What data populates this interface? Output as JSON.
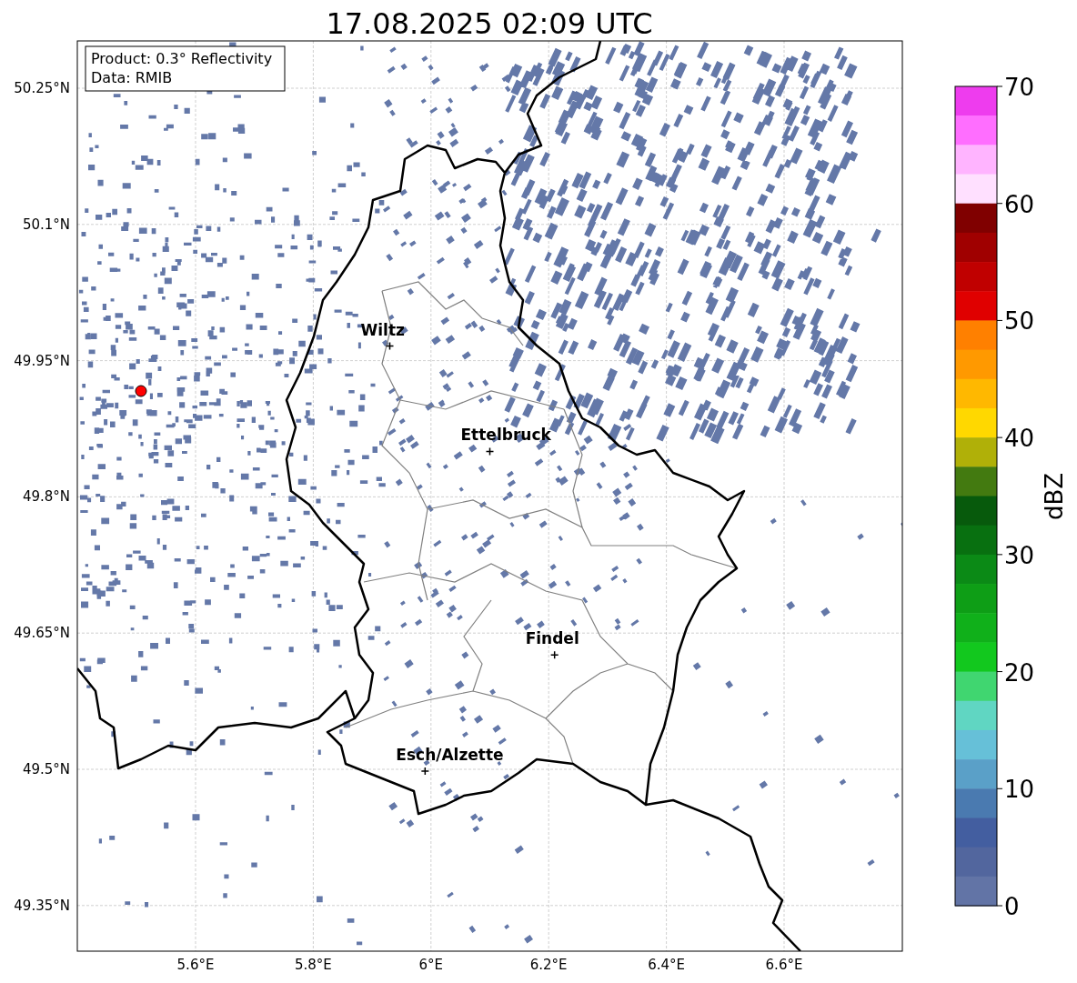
{
  "title": "17.08.2025 02:09 UTC",
  "info_box": [
    "Product: 0.3° Reflectivity",
    "Data: RMIB"
  ],
  "map": {
    "latitude_labels": [
      "50.25°N",
      "50.1°N",
      "49.95°N",
      "49.8°N",
      "49.65°N",
      "49.5°N",
      "49.35°N"
    ],
    "longitude_labels": [
      "5.6°E",
      "5.8°E",
      "6°E",
      "6.2°E",
      "6.4°E",
      "6.6°E"
    ],
    "cities": [
      {
        "name": "Wiltz"
      },
      {
        "name": "Ettelbruck"
      },
      {
        "name": "Findel"
      },
      {
        "name": "Esch/Alzette"
      }
    ]
  },
  "colorbar": {
    "label": "dBZ",
    "ticks": [
      "70",
      "60",
      "50",
      "40",
      "30",
      "20",
      "10",
      "0"
    ],
    "bins": [
      {
        "color": "#ee3cee"
      },
      {
        "color": "#ff6eff"
      },
      {
        "color": "#ffb4ff"
      },
      {
        "color": "#ffe0ff"
      },
      {
        "color": "#800000"
      },
      {
        "color": "#a00000"
      },
      {
        "color": "#c00000"
      },
      {
        "color": "#e00000"
      },
      {
        "color": "#ff8000"
      },
      {
        "color": "#ff9900"
      },
      {
        "color": "#ffb800"
      },
      {
        "color": "#ffd800"
      },
      {
        "color": "#b0b008"
      },
      {
        "color": "#437a10"
      },
      {
        "color": "#075a0c"
      },
      {
        "color": "#087010"
      },
      {
        "color": "#0b8a16"
      },
      {
        "color": "#0e9e16"
      },
      {
        "color": "#10b01a"
      },
      {
        "color": "#12c81e"
      },
      {
        "color": "#40d670"
      },
      {
        "color": "#60d6c2"
      },
      {
        "color": "#66c0d8"
      },
      {
        "color": "#5aa0c8"
      },
      {
        "color": "#4a7ab0"
      },
      {
        "color": "#435ea0"
      },
      {
        "color": "#52669e"
      },
      {
        "color": "#6274a6"
      }
    ]
  }
}
